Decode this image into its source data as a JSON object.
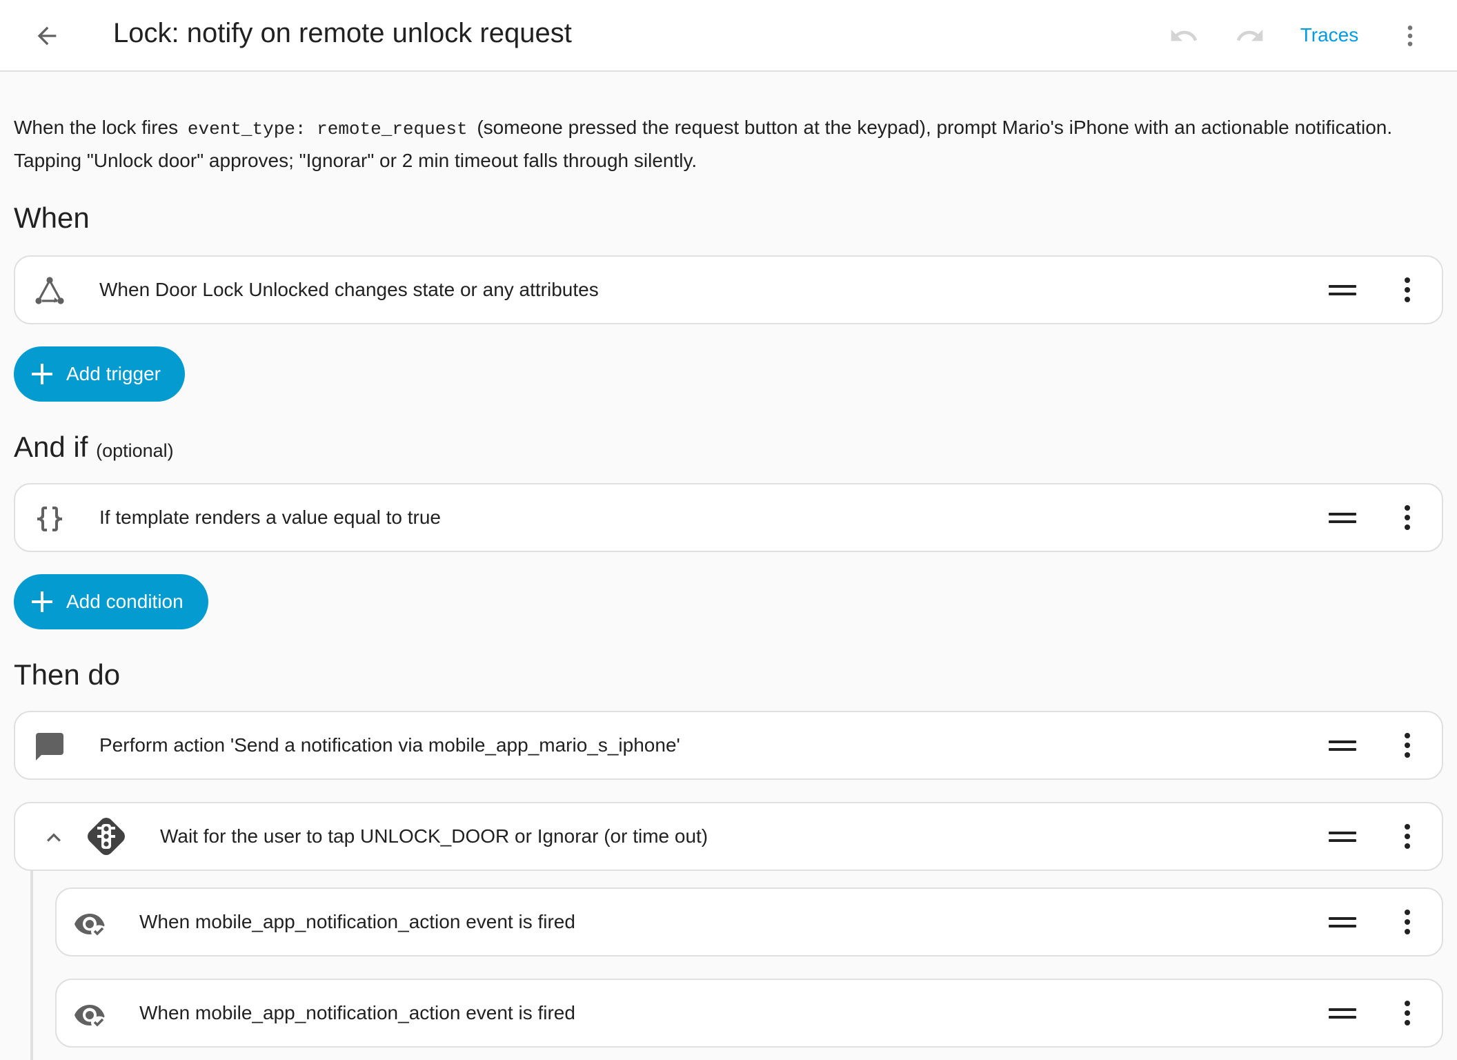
{
  "header": {
    "back_icon": "arrow-left-icon",
    "title": "Lock: notify on remote unlock request",
    "undo_icon": "undo-icon",
    "redo_icon": "redo-icon",
    "traces_label": "Traces",
    "overflow_icon": "dots-vertical-icon"
  },
  "description": {
    "part1": "When the lock fires",
    "code": "event_type: remote_request",
    "part2": "(someone pressed the request button at the keypad), prompt Mario's iPhone with an actionable notification.",
    "line2": "Tapping \"Unlock door\" approves; \"Ignorar\" or 2 min timeout falls through silently."
  },
  "when": {
    "title": "When",
    "triggers": [
      {
        "icon": "state-change-icon",
        "label": "When Door Lock Unlocked changes state or any attributes"
      }
    ],
    "add_label": "Add trigger"
  },
  "and_if": {
    "title": "And if",
    "optional_label": "(optional)",
    "conditions": [
      {
        "icon": "code-braces-icon",
        "label": "If template renders a value equal to true"
      }
    ],
    "add_label": "Add condition"
  },
  "then_do": {
    "title": "Then do",
    "actions": [
      {
        "icon": "message-icon",
        "label": "Perform action 'Send a notification via mobile_app_mario_s_iphone'"
      },
      {
        "icon": "traffic-light-icon",
        "label": "Wait for the user to tap UNLOCK_DOOR or Ignorar (or time out)",
        "expanded": true,
        "children": [
          {
            "icon": "eye-check-icon",
            "label": "When mobile_app_notification_action event is fired"
          },
          {
            "icon": "eye-check-icon",
            "label": "When mobile_app_notification_action event is fired"
          }
        ]
      }
    ]
  },
  "colors": {
    "accent": "#039bd0",
    "traces": "#039be5",
    "background": "#fafafa",
    "card": "#ffffff",
    "border": "#e0e0e0",
    "icon": "#616161"
  }
}
